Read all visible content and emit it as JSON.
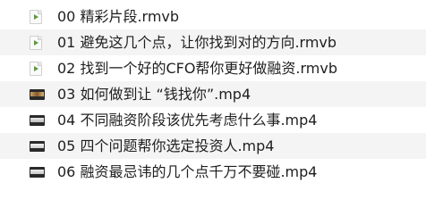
{
  "files": [
    {
      "name": "00 精彩片段.rmvb",
      "icon": "rmvb-file-icon"
    },
    {
      "name": "01 避免这几个点，让你找到对的方向.rmvb",
      "icon": "rmvb-file-icon"
    },
    {
      "name": "02 找到一个好的CFO帮你更好做融资.rmvb",
      "icon": "rmvb-file-icon"
    },
    {
      "name": "03 如何做到让 “钱找你”.mp4",
      "icon": "video-thumbnail-icon"
    },
    {
      "name": "04 不同融资阶段该优先考虑什么事.mp4",
      "icon": "video-thumbnail-icon"
    },
    {
      "name": "05 四个问题帮你选定投资人.mp4",
      "icon": "video-thumbnail-icon"
    },
    {
      "name": "06 融资最忌讳的几个点千万不要碰.mp4",
      "icon": "video-thumbnail-icon"
    }
  ]
}
